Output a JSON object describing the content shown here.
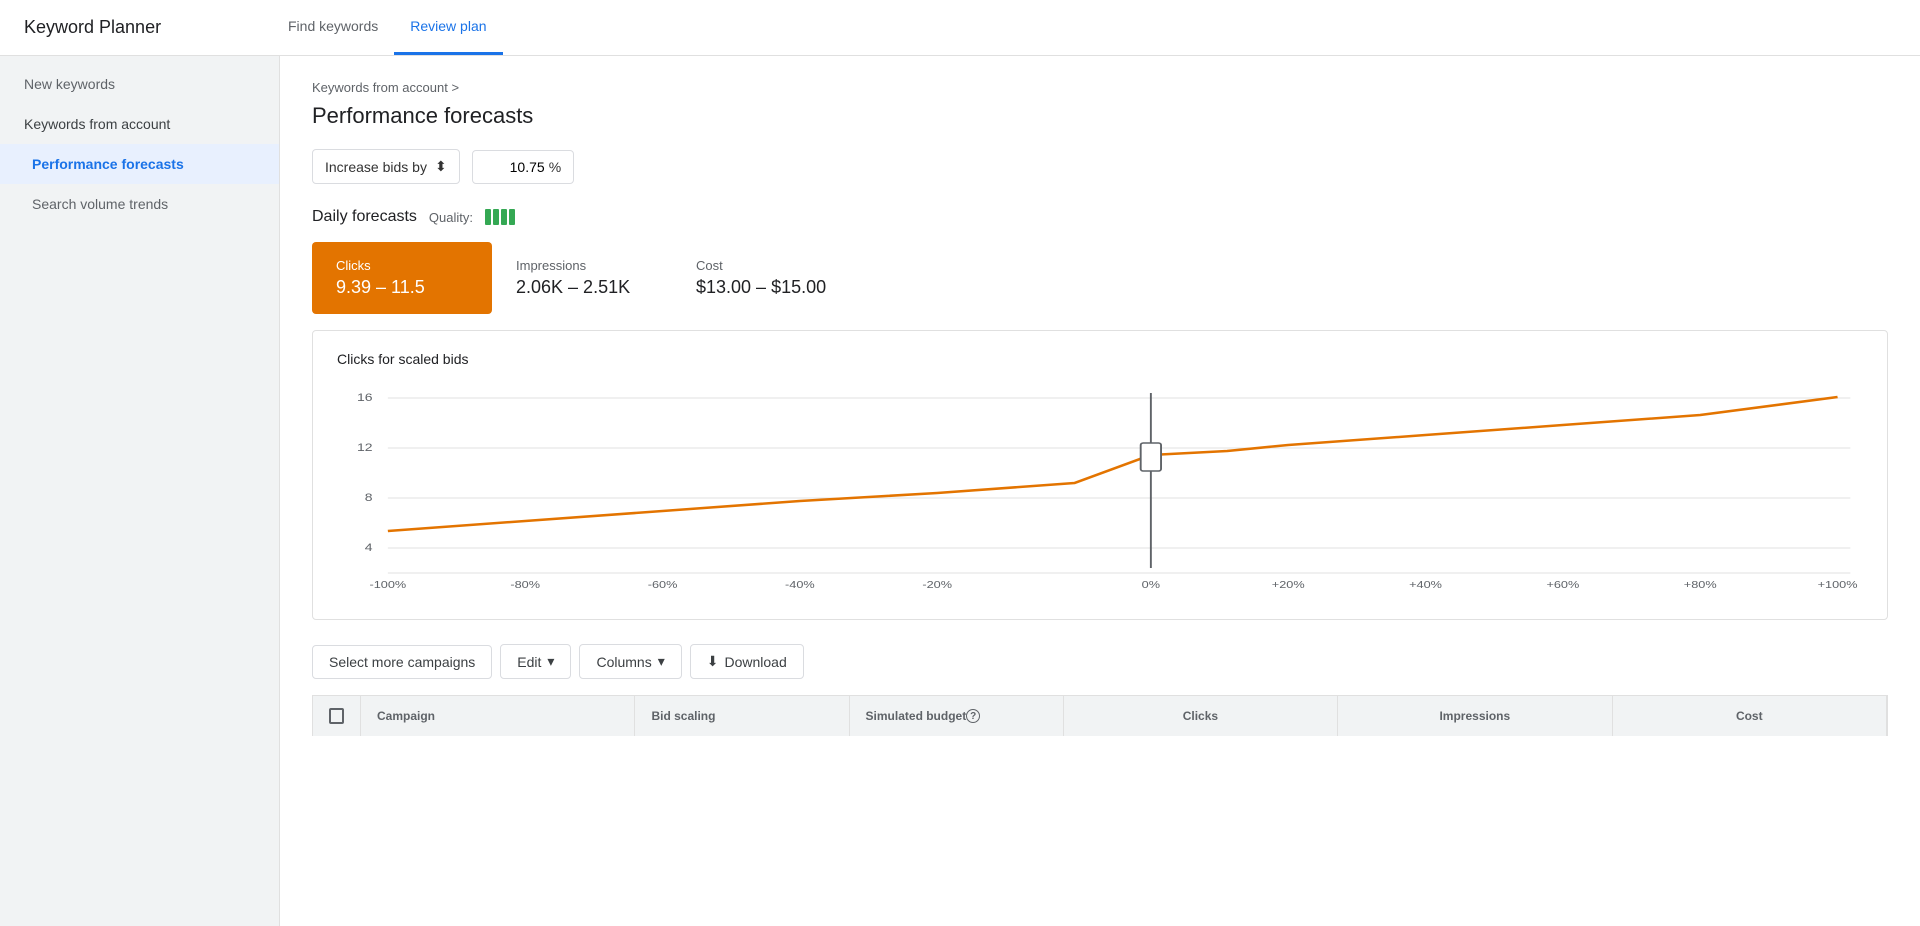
{
  "app": {
    "title": "Keyword Planner"
  },
  "nav": {
    "tabs": [
      {
        "id": "find-keywords",
        "label": "Find keywords",
        "active": false
      },
      {
        "id": "review-plan",
        "label": "Review plan",
        "active": true
      }
    ]
  },
  "sidebar": {
    "items": [
      {
        "id": "new-keywords",
        "label": "New keywords",
        "type": "top",
        "active": false
      },
      {
        "id": "keywords-from-account",
        "label": "Keywords from account",
        "type": "parent",
        "active": false
      },
      {
        "id": "performance-forecasts",
        "label": "Performance forecasts",
        "type": "child",
        "active": true
      },
      {
        "id": "search-volume-trends",
        "label": "Search volume trends",
        "type": "child",
        "active": false
      }
    ]
  },
  "breadcrumb": {
    "text": "Keywords from account >",
    "separator": ">"
  },
  "page": {
    "title": "Performance forecasts"
  },
  "bid_control": {
    "label": "Increase bids by",
    "value": "10.75",
    "unit": "%"
  },
  "daily_forecasts": {
    "title": "Daily forecasts",
    "quality_label": "Quality:",
    "cards": [
      {
        "id": "clicks",
        "label": "Clicks",
        "value": "9.39 – 11.5",
        "active": true
      },
      {
        "id": "impressions",
        "label": "Impressions",
        "value": "2.06K – 2.51K",
        "active": false
      },
      {
        "id": "cost",
        "label": "Cost",
        "value": "$13.00 – $15.00",
        "active": false
      }
    ]
  },
  "chart": {
    "title": "Clicks for scaled bids",
    "y_labels": [
      "16",
      "12",
      "8",
      "4"
    ],
    "x_labels": [
      "-100%",
      "-80%",
      "-60%",
      "-40%",
      "-20%",
      "0%",
      "+20%",
      "+40%",
      "+60%",
      "+80%",
      "+100%"
    ]
  },
  "actions": {
    "select_campaigns": "Select more campaigns",
    "edit": "Edit",
    "columns": "Columns",
    "download": "Download"
  },
  "table": {
    "headers": [
      "Campaign",
      "Bid scaling",
      "Simulated budget",
      "Clicks",
      "Impressions",
      "Cost"
    ],
    "sub_headers_clicks": [
      "",
      ""
    ],
    "sub_headers_impressions": [
      "",
      ""
    ],
    "sub_headers_cost": [
      "",
      ""
    ]
  }
}
